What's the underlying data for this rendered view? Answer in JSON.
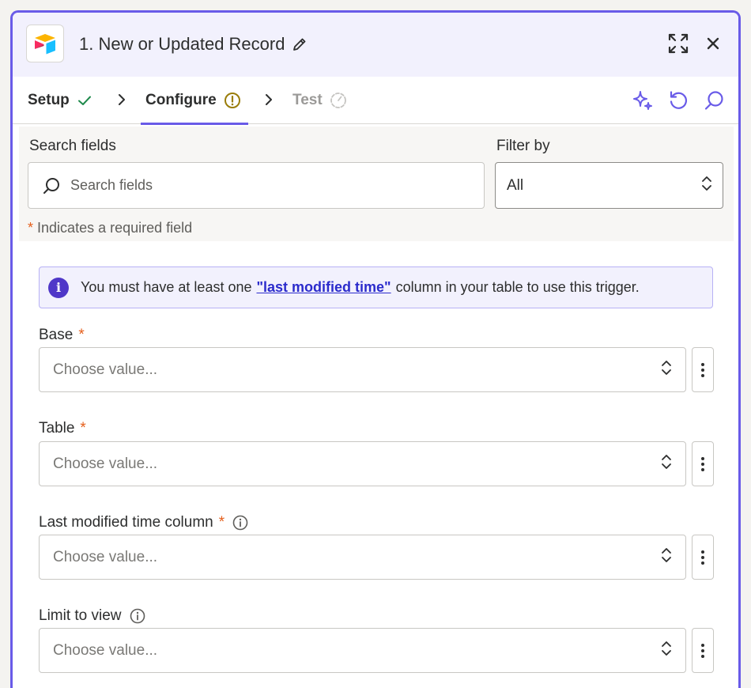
{
  "header": {
    "title": "1. New or Updated Record",
    "icons": {
      "logo": "airtable-logo",
      "edit": "pencil-icon",
      "expand": "expand-icon",
      "close": "close-icon"
    }
  },
  "tabs": [
    {
      "label": "Setup",
      "status_icon": "check-icon"
    },
    {
      "label": "Configure",
      "status_icon": "warning-circle-icon"
    },
    {
      "label": "Test",
      "status_icon": "timer-icon"
    }
  ],
  "toolbar": {
    "icons": [
      "sparkle-icon",
      "refresh-icon",
      "search-icon"
    ]
  },
  "search": {
    "label": "Search fields",
    "placeholder": "Search fields"
  },
  "filter": {
    "label": "Filter by",
    "value": "All"
  },
  "required_note": {
    "star": "*",
    "text": "Indicates a required field"
  },
  "info_banner": {
    "text_before": "You must have at least one",
    "link_text": "\"last modified time\"",
    "text_after": "column in your table to use this trigger."
  },
  "fields": [
    {
      "label": "Base",
      "required": "*",
      "placeholder": "Choose value..."
    },
    {
      "label": "Table",
      "required": "*",
      "placeholder": "Choose value..."
    },
    {
      "label": "Last modified time column",
      "required": "*",
      "placeholder": "Choose value..."
    },
    {
      "label": "Limit to view",
      "required": "",
      "placeholder": "Choose value..."
    }
  ],
  "colors": {
    "accent": "#695be8",
    "required_star": "#e55e1a",
    "link": "#2b2bcc",
    "success_check": "#1f8a4c",
    "warning": "#9a7d0a"
  }
}
